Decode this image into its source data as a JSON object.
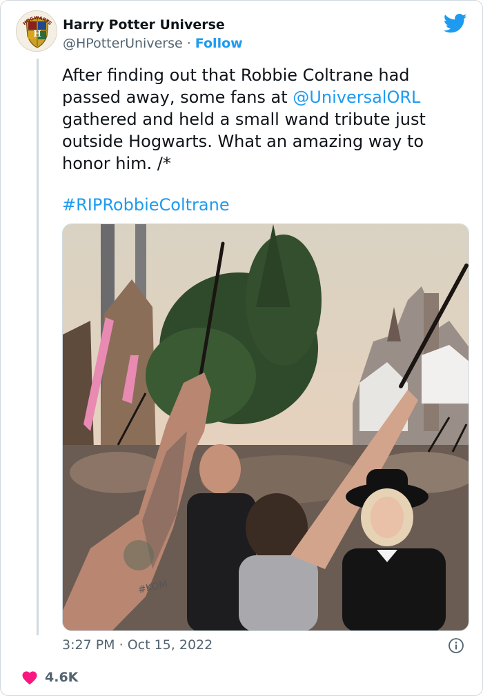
{
  "author": {
    "name": "Harry Potter Universe",
    "handle": "@HPotterUniverse",
    "separator": "·",
    "follow_label": "Follow",
    "avatar_crest_text": "HOGWARTS",
    "avatar_icon": "hogwarts-crest-icon"
  },
  "platform_icon": "twitter-bird-icon",
  "tweet": {
    "text_part1": "After finding out that Robbie Coltrane had passed away, some fans at ",
    "mention": "@UniversalORL",
    "text_part2": " gathered and held a small wand tribute just outside Hogwarts. What an amazing way to honor him. /*",
    "hashtag": "#RIPRobbieColtrane"
  },
  "media": {
    "icon": "photo-wand-tribute",
    "shirt_text": "#KOM"
  },
  "meta": {
    "time": "3:27 PM",
    "separator": "·",
    "date": "Oct 15, 2022",
    "info_icon": "info-icon"
  },
  "engagement": {
    "like_icon": "heart-icon",
    "like_count": "4.6K"
  },
  "colors": {
    "link": "#1d9bf0",
    "heart": "#f91880",
    "text": "#0f1419",
    "secondary": "#536471"
  }
}
